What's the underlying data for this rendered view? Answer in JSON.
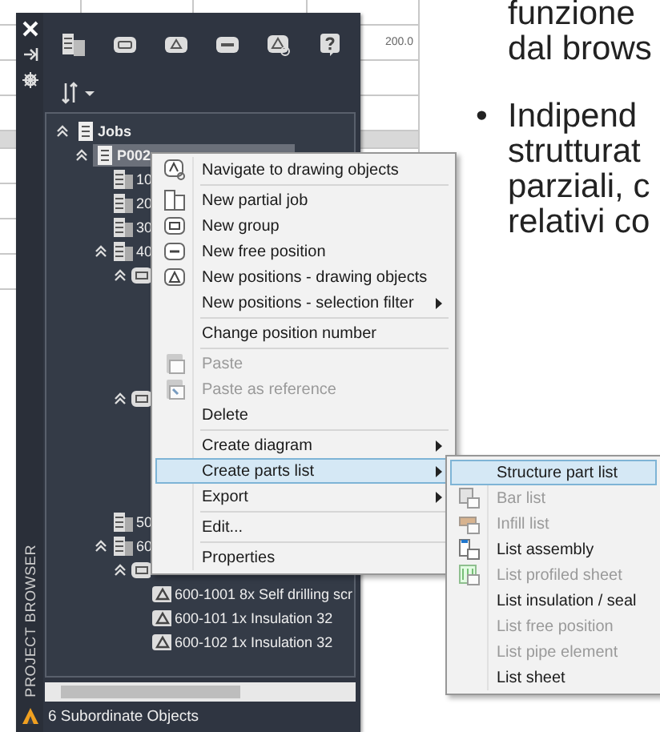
{
  "table": {
    "cells": [
      "200.0"
    ]
  },
  "document": {
    "paragraphs": [
      {
        "lines": [
          "funzione",
          "dal brows"
        ]
      },
      {
        "bullet": true,
        "bullet_mark": "•",
        "lines": [
          "Indipend",
          "strutturat",
          "parziali, c",
          "relativi co"
        ]
      }
    ]
  },
  "panel": {
    "side_title": "PROJECT BROWSER",
    "status": "6 Subordinate Objects",
    "tree": [
      {
        "label": "Jobs",
        "kind": "job",
        "expanded": true,
        "selected": false,
        "children": [
          {
            "label": "P002",
            "kind": "job",
            "expanded": true,
            "selected": true,
            "children": [
              {
                "label": "10",
                "kind": "partial",
                "selected": false
              },
              {
                "label": "20",
                "kind": "partial",
                "selected": false
              },
              {
                "label": "30",
                "kind": "partial",
                "selected": false
              },
              {
                "label": "40",
                "kind": "partial",
                "expanded": true,
                "selected": false,
                "children": [
                  {
                    "kind": "group",
                    "expanded": true,
                    "selected": false
                  },
                  {
                    "kind": "group",
                    "expanded": true,
                    "selected": false
                  }
                ]
              },
              {
                "label": "50",
                "kind": "partial",
                "selected": false
              },
              {
                "label": "60",
                "kind": "partial",
                "expanded": true,
                "selected": false,
                "children": [
                  {
                    "kind": "group",
                    "expanded": true,
                    "selected": false,
                    "children": [
                      {
                        "label": "600-1001 8x Self drilling scr",
                        "kind": "position",
                        "selected": false
                      },
                      {
                        "label": "600-101 1x Insulation 32",
                        "kind": "position",
                        "selected": false
                      },
                      {
                        "label": "600-102 1x Insulation 32",
                        "kind": "position",
                        "selected": false
                      }
                    ]
                  }
                ]
              }
            ]
          }
        ]
      }
    ]
  },
  "context_menu": {
    "items": [
      {
        "kind": "navigate",
        "label": "Navigate to drawing objects",
        "disabled": false,
        "submenu": false,
        "selected": false
      },
      {
        "kind": "separator"
      },
      {
        "kind": "partial-job",
        "label": "New partial job",
        "disabled": false,
        "submenu": false,
        "selected": false
      },
      {
        "kind": "group",
        "label": "New group",
        "disabled": false,
        "submenu": false,
        "selected": false
      },
      {
        "kind": "free-position",
        "label": "New free position",
        "disabled": false,
        "submenu": false,
        "selected": false
      },
      {
        "kind": "positions",
        "label": "New positions - drawing objects",
        "disabled": false,
        "submenu": false,
        "selected": false
      },
      {
        "kind": "plain",
        "label": "New positions - selection filter",
        "disabled": false,
        "submenu": true,
        "selected": false
      },
      {
        "kind": "separator"
      },
      {
        "kind": "plain",
        "label": "Change position number",
        "disabled": false,
        "submenu": false,
        "selected": false
      },
      {
        "kind": "separator"
      },
      {
        "kind": "paste",
        "label": "Paste",
        "disabled": true,
        "submenu": false,
        "selected": false
      },
      {
        "kind": "paste-ref",
        "label": "Paste as reference",
        "disabled": true,
        "submenu": false,
        "selected": false
      },
      {
        "kind": "plain",
        "label": "Delete",
        "disabled": false,
        "submenu": false,
        "selected": false
      },
      {
        "kind": "separator"
      },
      {
        "kind": "plain",
        "label": "Create diagram",
        "disabled": false,
        "submenu": true,
        "selected": false
      },
      {
        "kind": "plain",
        "label": "Create parts list",
        "disabled": false,
        "submenu": true,
        "selected": true
      },
      {
        "kind": "plain",
        "label": "Export",
        "disabled": false,
        "submenu": true,
        "selected": false
      },
      {
        "kind": "separator"
      },
      {
        "kind": "plain",
        "label": "Edit...",
        "disabled": false,
        "submenu": false,
        "selected": false
      },
      {
        "kind": "separator"
      },
      {
        "kind": "plain",
        "label": "Properties",
        "disabled": false,
        "submenu": false,
        "selected": false
      }
    ]
  },
  "submenu": {
    "items": [
      {
        "kind": "plain",
        "label": "Structure part list",
        "disabled": false,
        "selected": true
      },
      {
        "kind": "bar",
        "label": "Bar list",
        "disabled": true,
        "selected": false
      },
      {
        "kind": "infill",
        "label": "Infill list",
        "disabled": true,
        "selected": false
      },
      {
        "kind": "assembly",
        "label": "List assembly",
        "disabled": false,
        "selected": false
      },
      {
        "kind": "sheet",
        "label": "List profiled sheet",
        "disabled": true,
        "selected": false
      },
      {
        "kind": "plain",
        "label": "List insulation / seal",
        "disabled": false,
        "selected": false
      },
      {
        "kind": "plain",
        "label": "List free position",
        "disabled": true,
        "selected": false
      },
      {
        "kind": "plain",
        "label": "List pipe element",
        "disabled": true,
        "selected": false
      },
      {
        "kind": "plain",
        "label": "List sheet",
        "disabled": false,
        "selected": false
      }
    ]
  }
}
